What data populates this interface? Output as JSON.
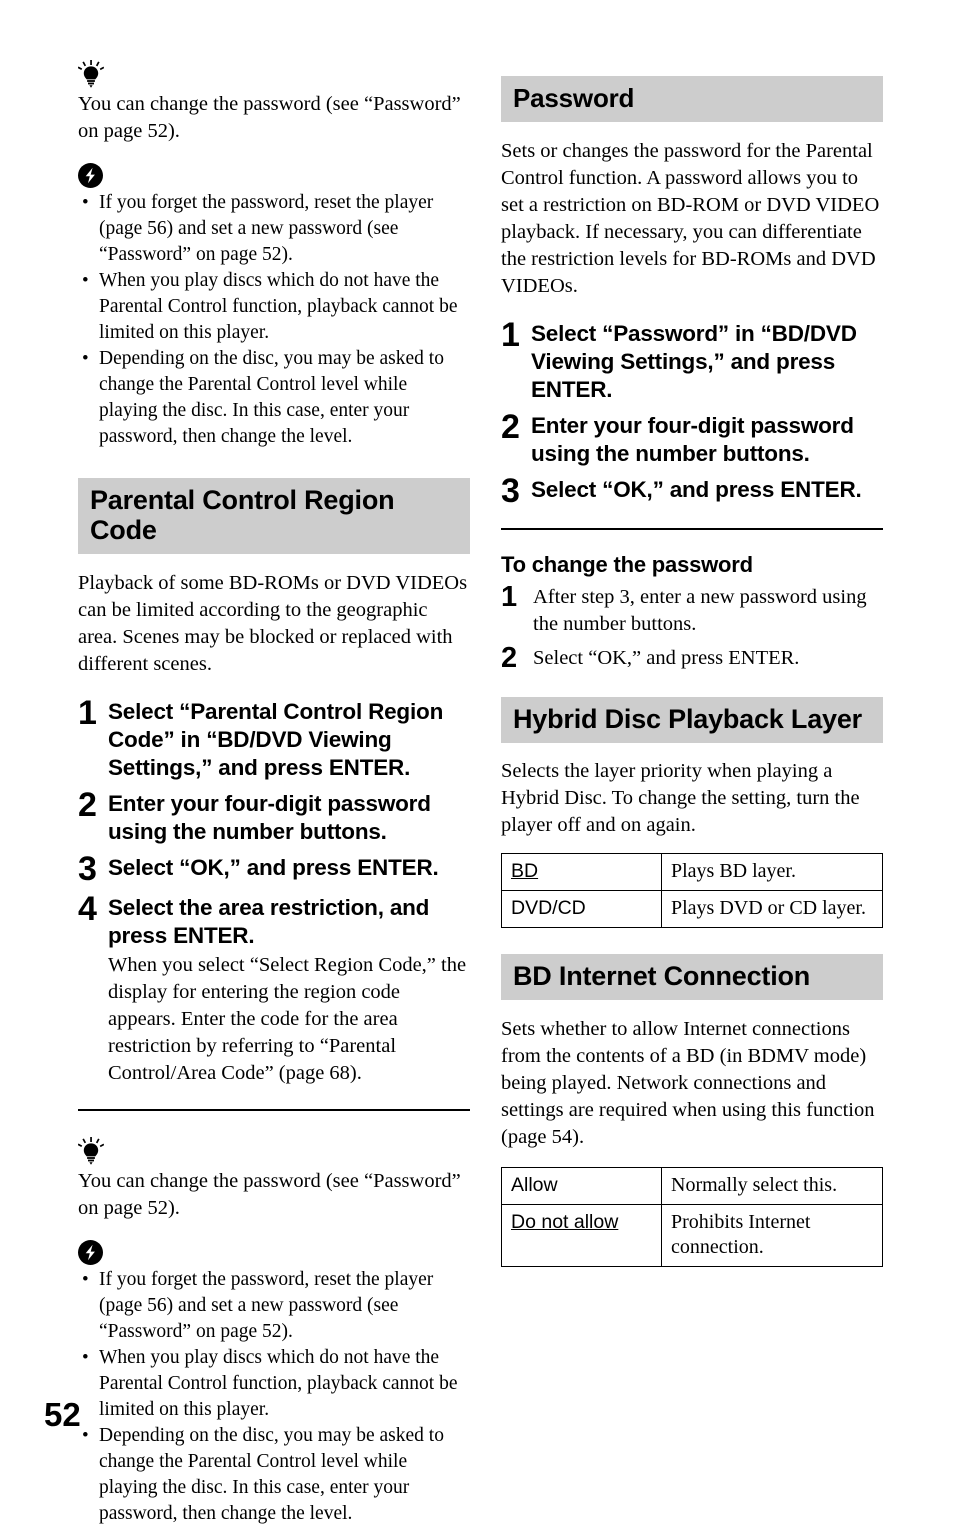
{
  "page": {
    "number": "52"
  },
  "icons": {
    "tip": "lightbulb-tip-icon",
    "note": "lightning-note-icon"
  },
  "left_column": {
    "tip_top": {
      "text": "You can change the password (see “Password” on page 52)."
    },
    "note_top": {
      "bullets": [
        "If you forget the password, reset the player (page 56) and set a new password (see “Password” on page 52).",
        "When you play discs which do not have the Parental Control function, playback cannot be limited on this player.",
        "Depending on the disc, you may be asked to change the Parental Control level while playing the disc. In this case, enter your password, then change the level."
      ]
    },
    "section": {
      "title": "Parental Control Region Code",
      "intro": "Playback of some BD-ROMs or DVD VIDEOs can be limited according to the geographic area. Scenes may be blocked or replaced with different scenes.",
      "steps": [
        {
          "num": "1",
          "title": "Select “Parental Control Region Code” in “BD/DVD Viewing Settings,” and press ENTER."
        },
        {
          "num": "2",
          "title": "Enter your four-digit password using the number buttons."
        },
        {
          "num": "3",
          "title": "Select “OK,” and press ENTER."
        },
        {
          "num": "4",
          "title": "Select the area restriction, and press ENTER.",
          "note": "When you select “Select Region Code,” the display for entering the region code appears. Enter the code for the area restriction by referring to “Parental Control/Area Code” (page 68)."
        }
      ]
    },
    "tip_bottom": {
      "text": "You can change the password (see “Password” on page 52)."
    },
    "note_bottom": {
      "bullets": [
        "If you forget the password, reset the player (page 56) and set a new password (see “Password” on page 52).",
        "When you play discs which do not have the Parental Control function, playback cannot be limited on this player.",
        "Depending on the disc, you may be asked to change the Parental Control level while playing the disc. In this case, enter your password, then change the level."
      ]
    }
  },
  "right_column": {
    "password": {
      "title": "Password",
      "intro": "Sets or changes the password for the Parental Control function. A password allows you to set a restriction on BD-ROM or DVD VIDEO playback. If necessary, you can differentiate the restriction levels for BD-ROMs and DVD VIDEOs.",
      "steps": [
        {
          "num": "1",
          "title": "Select “Password” in “BD/DVD Viewing Settings,” and press ENTER."
        },
        {
          "num": "2",
          "title": "Enter your four-digit password using the number buttons."
        },
        {
          "num": "3",
          "title": "Select “OK,” and press ENTER."
        }
      ],
      "subsection": {
        "heading": "To change the password",
        "steps": [
          {
            "num": "1",
            "title": "After step 3, enter a new password using the number buttons."
          },
          {
            "num": "2",
            "title": "Select “OK,” and press ENTER."
          }
        ]
      }
    },
    "hybrid": {
      "title": "Hybrid Disc Playback Layer",
      "intro": "Selects the layer priority when playing a Hybrid Disc. To change the setting, turn the player off and on again.",
      "table": [
        {
          "key": "BD",
          "value": "Plays BD layer.",
          "default": true
        },
        {
          "key": "DVD/CD",
          "value": "Plays DVD or CD layer.",
          "default": false
        }
      ]
    },
    "bd_internet": {
      "title": "BD Internet Connection",
      "intro": "Sets whether to allow Internet connections from the contents of a BD (in BDMV mode) being played. Network connections and settings are required when using this function (page 54).",
      "table": [
        {
          "key": "Allow",
          "value": "Normally select this.",
          "default": false
        },
        {
          "key": "Do not allow",
          "value": "Prohibits Internet connection.",
          "default": true
        }
      ]
    }
  },
  "colors": {
    "band_gray": "#cdcdcd",
    "text": "#000000",
    "background": "#ffffff"
  }
}
